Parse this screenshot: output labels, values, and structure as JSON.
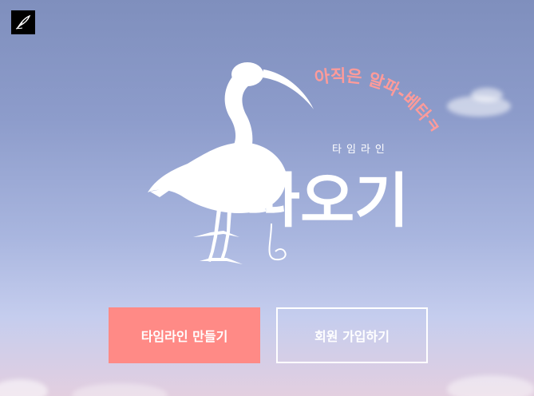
{
  "app": {
    "icon": "quill-pen-icon"
  },
  "logo": {
    "tagline": "아직은 알파-베타ㅋ",
    "subtitle": "타임라인",
    "title": "따오기",
    "tagline_color": "#ff9b9a",
    "mascot": "ibis-bird-icon"
  },
  "actions": {
    "create_timeline_label": "타임라인 만들기",
    "signup_label": "회원 가입하기",
    "primary_color": "#ff8a86"
  }
}
